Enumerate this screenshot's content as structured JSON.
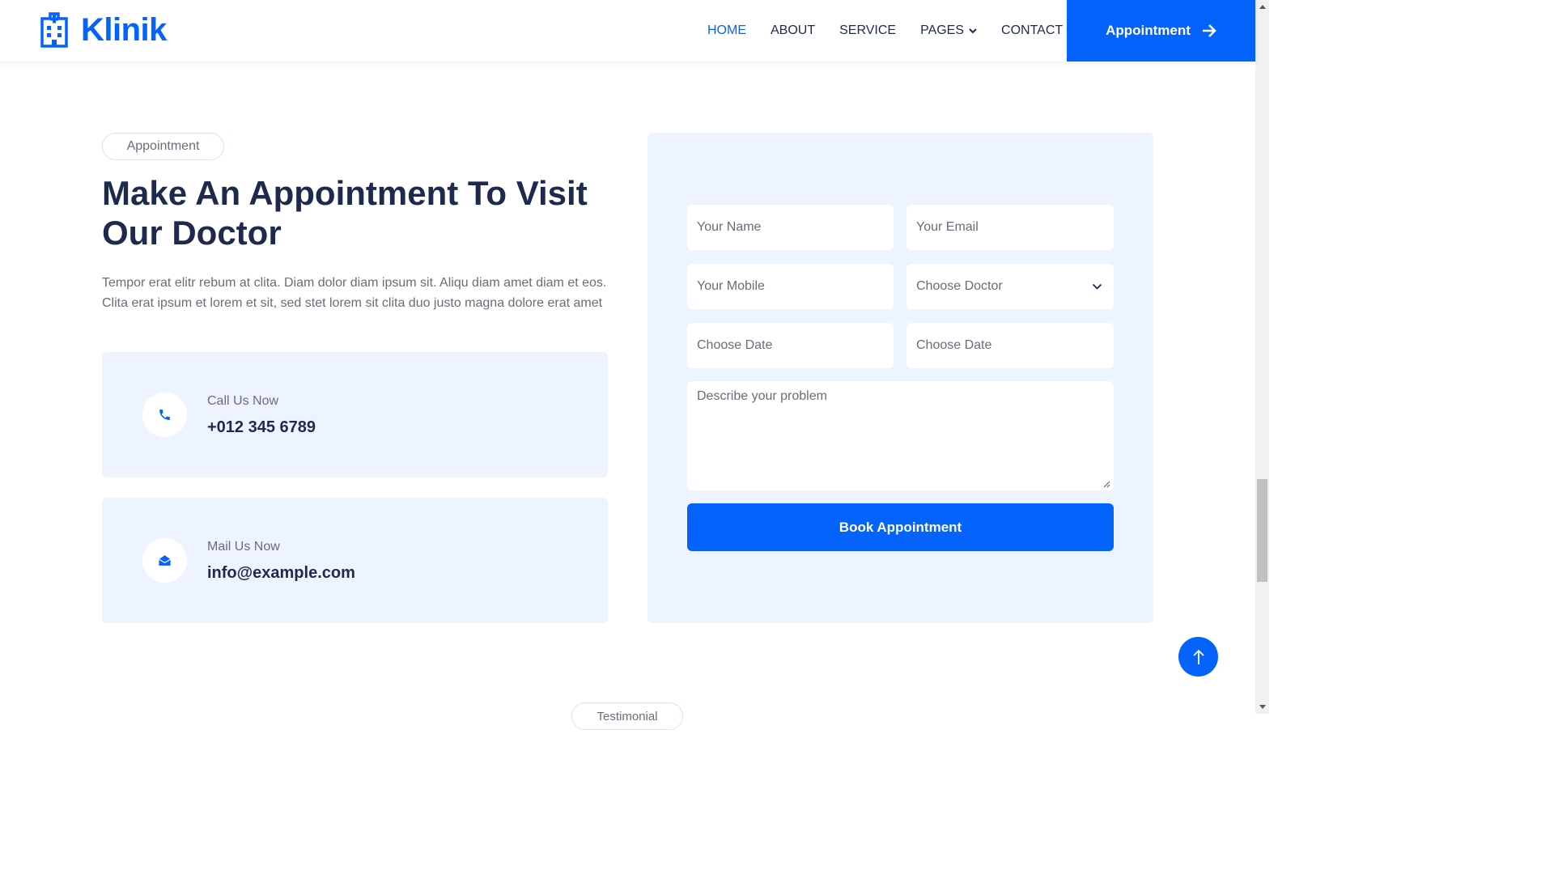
{
  "brand": {
    "name": "Klinik",
    "icon": "hospital-building-icon",
    "color": "#0463fa"
  },
  "nav": {
    "items": [
      {
        "label": "HOME",
        "active": true
      },
      {
        "label": "ABOUT",
        "active": false
      },
      {
        "label": "SERVICE",
        "active": false
      },
      {
        "label": "PAGES",
        "active": false,
        "dropdown": true
      },
      {
        "label": "CONTACT",
        "active": false
      }
    ],
    "cta_label": "Appointment"
  },
  "section": {
    "tag": "Appointment",
    "heading_line1": "Make An Appointment To Visit",
    "heading_line2": "Our Doctor",
    "description": "Tempor erat elitr rebum at clita. Diam dolor diam ipsum sit. Aliqu diam amet diam et eos. Clita erat ipsum et lorem et sit, sed stet lorem sit clita duo justo magna dolore erat amet"
  },
  "contacts": {
    "call": {
      "label": "Call Us Now",
      "value": "+012 345 6789",
      "icon": "phone-icon"
    },
    "mail": {
      "label": "Mail Us Now",
      "value": "info@example.com",
      "icon": "envelope-open-icon"
    }
  },
  "form": {
    "name_placeholder": "Your Name",
    "email_placeholder": "Your Email",
    "mobile_placeholder": "Your Mobile",
    "doctor_selected": "Choose Doctor",
    "date_placeholder": "Choose Date",
    "time_placeholder": "Choose Date",
    "problem_placeholder": "Describe your problem",
    "submit_label": "Book Appointment"
  },
  "bottom": {
    "next_tag": "Testimonial"
  },
  "colors": {
    "primary": "#0463fa",
    "panel_bg": "#eef4ff",
    "heading": "#1d2a4d",
    "text": "#6b6b7b"
  }
}
